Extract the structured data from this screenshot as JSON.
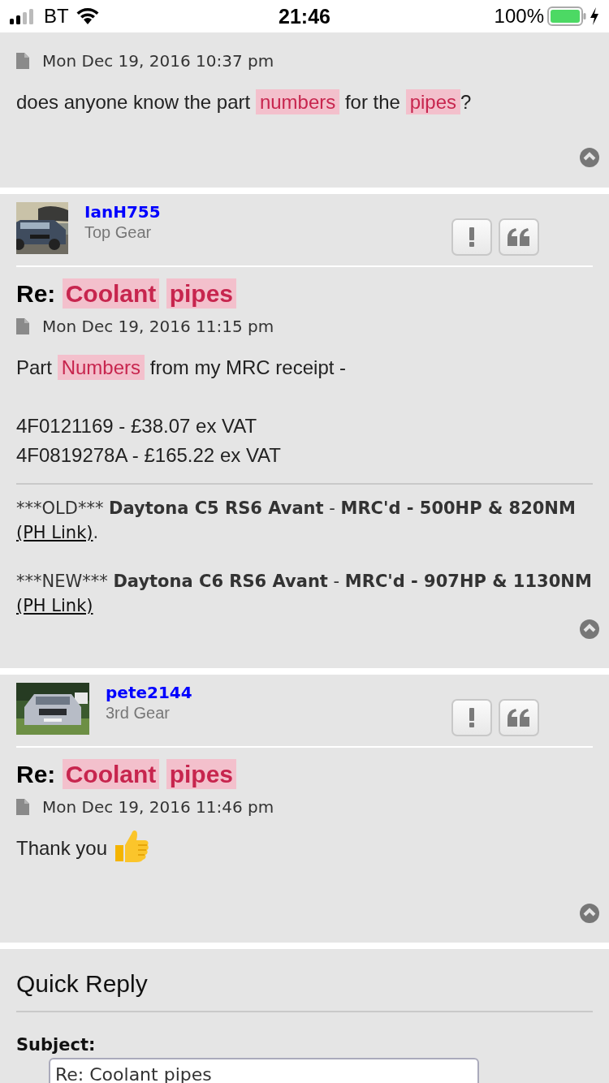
{
  "status_bar": {
    "carrier": "BT",
    "time": "21:46",
    "battery": "100%",
    "charging": true
  },
  "posts": [
    {
      "date": "Mon Dec 19, 2016 10:37 pm",
      "body": [
        {
          "kind": "text",
          "segments": [
            {
              "text": "does anyone know the part",
              "highlight": false
            },
            {
              "text": "numbers",
              "highlight": true
            },
            {
              "text": "for the",
              "highlight": false
            },
            {
              "text": "pipes",
              "highlight": true
            },
            {
              "text": "?",
              "highlight": false,
              "attach": true
            }
          ]
        }
      ]
    },
    {
      "author": {
        "name": "IanH755",
        "rank": "Top Gear"
      },
      "title": [
        {
          "text": "Re:",
          "highlight": false
        },
        {
          "text": "Coolant",
          "highlight": true
        },
        {
          "text": "pipes",
          "highlight": true
        }
      ],
      "date": "Mon Dec 19, 2016 11:15 pm",
      "body": [
        {
          "kind": "text",
          "segments": [
            {
              "text": "Part",
              "highlight": false
            },
            {
              "text": "Numbers",
              "highlight": true
            },
            {
              "text": "from my MRC receipt -",
              "highlight": false
            }
          ]
        },
        {
          "kind": "text",
          "segments": [
            {
              "text": "4F0121169 - £38.07 ex VAT",
              "highlight": false
            }
          ],
          "gap": true
        },
        {
          "kind": "text",
          "segments": [
            {
              "text": "4F0819278A - £165.22 ex VAT",
              "highlight": false
            }
          ]
        }
      ],
      "signature": [
        {
          "parts": [
            {
              "text": "***OLD***",
              "bold": false
            },
            {
              "text": "Daytona C5 RS6 Avant",
              "bold": true
            },
            {
              "text": "-",
              "bold": false
            },
            {
              "text": "MRC'd - 500HP & 820NM",
              "bold": true
            }
          ],
          "link": "(PH Link)",
          "after": "."
        },
        {
          "parts": [
            {
              "text": "***NEW***",
              "bold": false
            },
            {
              "text": "Daytona C6 RS6 Avant",
              "bold": true
            },
            {
              "text": "-",
              "bold": false
            },
            {
              "text": "MRC'd - 907HP & 1130NM",
              "bold": true
            }
          ],
          "link": "(PH Link)"
        }
      ]
    },
    {
      "author": {
        "name": "pete2144",
        "rank": "3rd Gear"
      },
      "title": [
        {
          "text": "Re:",
          "highlight": false
        },
        {
          "text": "Coolant",
          "highlight": true
        },
        {
          "text": "pipes",
          "highlight": true
        }
      ],
      "date": "Mon Dec 19, 2016 11:46 pm",
      "body": [
        {
          "kind": "text_with_thumbs_up",
          "segments": [
            {
              "text": "Thank you",
              "highlight": false
            }
          ]
        }
      ]
    }
  ],
  "quick_reply": {
    "title": "Quick Reply",
    "subject_label": "Subject:",
    "subject_value": "Re: Coolant pipes"
  }
}
